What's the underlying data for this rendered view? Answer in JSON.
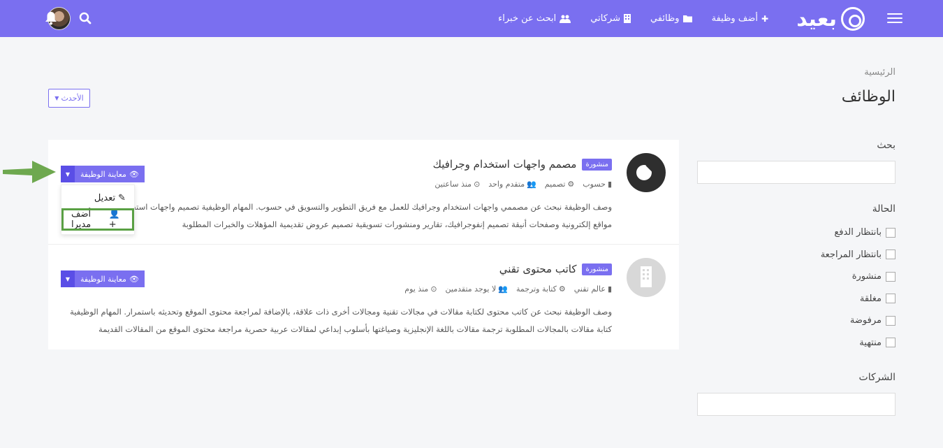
{
  "nav": {
    "logo_text": "بعيد",
    "links": [
      {
        "label": "أضف وظيفة",
        "icon": "plus-icon"
      },
      {
        "label": "وظائفي",
        "icon": "folder-icon"
      },
      {
        "label": "شركاتي",
        "icon": "building-icon"
      },
      {
        "label": "ابحث عن خبراء",
        "icon": "users-icon"
      }
    ]
  },
  "breadcrumb": "الرئيسية",
  "page_title": "الوظائف",
  "sort_label": "الأحدث",
  "sidebar": {
    "search_label": "بحث",
    "status_label": "الحالة",
    "statuses": [
      "بانتظار الدفع",
      "بانتظار المراجعة",
      "منشورة",
      "مغلقة",
      "مرفوضة",
      "منتهية"
    ],
    "companies_label": "الشركات"
  },
  "jobs": [
    {
      "status": "منشورة",
      "title": "مصمم واجهات استخدام وجرافيك",
      "company": "حسوب",
      "category": "تصميم",
      "level": "متقدم واحد",
      "time": "منذ ساعتين",
      "desc": "وصف الوظيفة نبحث عن مصممي واجهات استخدام وجرافيك للعمل مع فريق التطوير والتسويق في حسوب. المهام الوظيفية تصميم واجهات استخدام الجوال تصميم مواقع إلكترونية وصفحات أنيقة تصميم إنفوجرافيك، تقارير ومنشورات تسويقية تصميم عروض تقديمية المؤهلات والخبرات المطلوبة",
      "view_label": "معاينة الوظيفة"
    },
    {
      "status": "منشورة",
      "title": "كاتب محتوى تقني",
      "company": "عالم تقني",
      "category": "كتابة وترجمة",
      "level": "لا يوجد متقدمين",
      "time": "منذ يوم",
      "desc": "وصف الوظيفة نبحث عن كاتب محتوى لكتابة مقالات في مجالات تقنية ومجالات أخرى ذات علاقة، بالإضافة لمراجعة محتوى الموقع وتحديثه باستمرار. المهام الوظيفية كتابة مقالات بالمجالات المطلوبة ترجمة مقالات باللغة الإنجليزية وصياغتها بأسلوب إبداعي لمقالات عربية حصرية مراجعة محتوى الموقع من المقالات القديمة تحديث...",
      "view_label": "معاينة الوظيفة"
    }
  ],
  "dropdown": {
    "edit_label": "تعديل",
    "add_manager_label": "أضف مديرا"
  },
  "colors": {
    "primary": "#7a6ff0",
    "primary_dark": "#5a4ee6",
    "highlight": "#5aa044"
  }
}
